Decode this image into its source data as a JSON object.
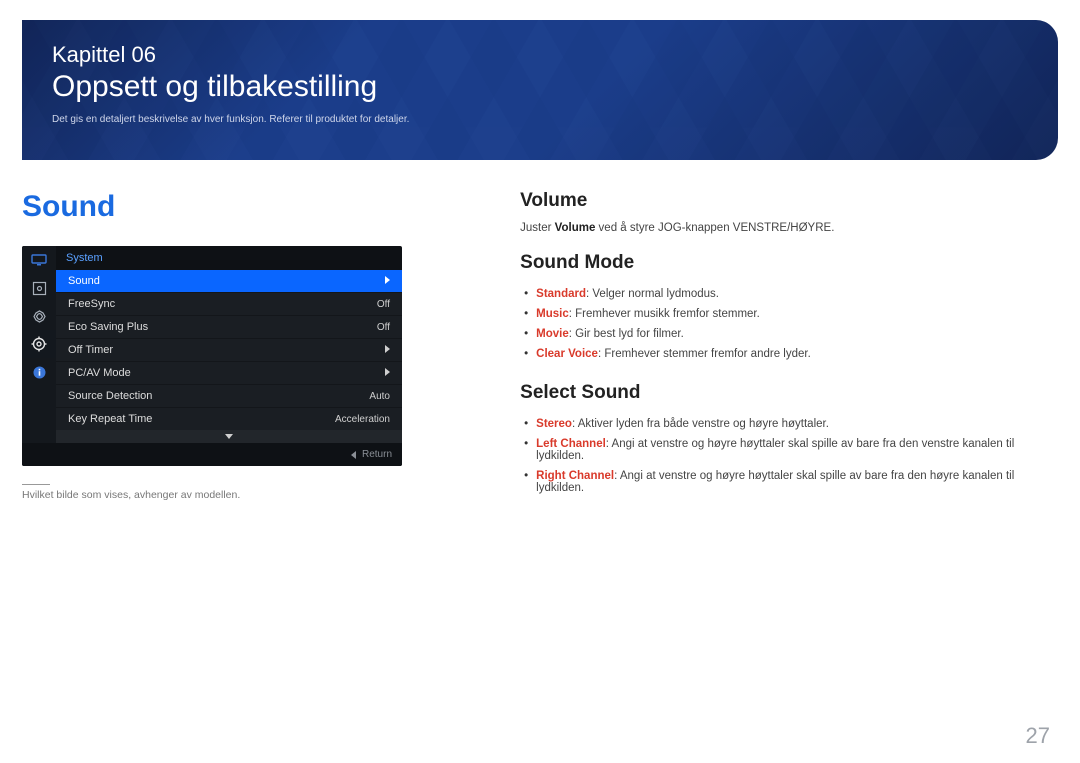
{
  "banner": {
    "chapter": "Kapittel 06",
    "title": "Oppsett og tilbakestilling",
    "subtitle": "Det gis en detaljert beskrivelse av hver funksjon. Referer til produktet for detaljer."
  },
  "left": {
    "heading": "Sound",
    "osd": {
      "header": "System",
      "items": [
        {
          "label": "Sound",
          "value": "",
          "selected": true,
          "arrow": true
        },
        {
          "label": "FreeSync",
          "value": "Off",
          "selected": false,
          "arrow": false
        },
        {
          "label": "Eco Saving Plus",
          "value": "Off",
          "selected": false,
          "arrow": false
        },
        {
          "label": "Off Timer",
          "value": "",
          "selected": false,
          "arrow": true
        },
        {
          "label": "PC/AV Mode",
          "value": "",
          "selected": false,
          "arrow": true
        },
        {
          "label": "Source Detection",
          "value": "Auto",
          "selected": false,
          "arrow": false
        },
        {
          "label": "Key Repeat Time",
          "value": "Acceleration",
          "selected": false,
          "arrow": false
        }
      ],
      "return": "Return"
    },
    "footnote": "Hvilket bilde som vises, avhenger av modellen."
  },
  "right": {
    "volume": {
      "heading": "Volume",
      "text_pre": "Juster ",
      "text_bold": "Volume",
      "text_post": " ved å styre JOG-knappen VENSTRE/HØYRE."
    },
    "soundmode": {
      "heading": "Sound Mode",
      "items": [
        {
          "term": "Standard",
          "desc": ": Velger normal lydmodus."
        },
        {
          "term": "Music",
          "desc": ": Fremhever musikk fremfor stemmer."
        },
        {
          "term": "Movie",
          "desc": ": Gir best lyd for filmer."
        },
        {
          "term": "Clear Voice",
          "desc": ": Fremhever stemmer fremfor andre lyder."
        }
      ]
    },
    "selectsound": {
      "heading": "Select Sound",
      "items": [
        {
          "term": "Stereo",
          "desc": ": Aktiver lyden fra både venstre og høyre høyttaler."
        },
        {
          "term": "Left Channel",
          "desc": ": Angi at venstre og høyre høyttaler skal spille av bare fra den venstre kanalen til lydkilden."
        },
        {
          "term": "Right Channel",
          "desc": ": Angi at venstre og høyre høyttaler skal spille av bare fra den høyre kanalen til lydkilden."
        }
      ]
    }
  },
  "page": "27"
}
